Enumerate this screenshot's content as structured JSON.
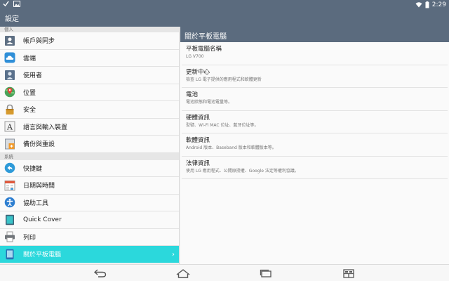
{
  "status_bar": {
    "left_icons": [
      "check-icon",
      "image-icon"
    ],
    "right_icons": [
      "wifi-icon",
      "battery-icon"
    ],
    "time": "2:29"
  },
  "action_bar": {
    "title": "設定"
  },
  "left_list": {
    "section_personal": "個人",
    "section_system": "系統",
    "items": [
      {
        "label": "帳戶與同步",
        "icon": "accounts-sync-icon"
      },
      {
        "label": "雲端",
        "icon": "cloud-icon"
      },
      {
        "label": "使用者",
        "icon": "users-icon"
      },
      {
        "label": "位置",
        "icon": "location-icon"
      },
      {
        "label": "安全",
        "icon": "lock-icon"
      },
      {
        "label": "語言與輸入裝置",
        "icon": "language-icon"
      },
      {
        "label": "備份與重設",
        "icon": "backup-icon"
      },
      {
        "label": "快捷鍵",
        "icon": "shortcut-icon"
      },
      {
        "label": "日期與時間",
        "icon": "calendar-icon"
      },
      {
        "label": "協助工具",
        "icon": "accessibility-icon"
      },
      {
        "label": "Quick Cover",
        "icon": "quick-cover-icon"
      },
      {
        "label": "列印",
        "icon": "printer-icon"
      },
      {
        "label": "關於平板電腦",
        "icon": "tablet-icon"
      }
    ],
    "selected_chevron": "›"
  },
  "right_pane": {
    "title": "關於平板電腦",
    "items": [
      {
        "title": "平板電腦名稱",
        "subtitle": "LG V700"
      },
      {
        "title": "更新中心",
        "subtitle": "檢查 LG 電子提供的應用程式和軟體更新"
      },
      {
        "title": "電池",
        "subtitle": "電池狀態和電池電量等。"
      },
      {
        "title": "硬體資訊",
        "subtitle": "型號、Wi-Fi MAC 位址、藍牙位址等。"
      },
      {
        "title": "軟體資訊",
        "subtitle": "Android 版本、Baseband 版本和軟體版本等。"
      },
      {
        "title": "法律資訊",
        "subtitle": "使用 LG 應用程式、公開原授權、Google 法定等權利協議。"
      }
    ]
  },
  "nav_bar": {
    "buttons": [
      "back-icon",
      "home-icon",
      "recent-apps-icon",
      "dual-window-icon"
    ]
  },
  "colors": {
    "header_bg": "#5b6b7e",
    "accent": "#2bd8dc",
    "list_bg": "#fafafa"
  }
}
